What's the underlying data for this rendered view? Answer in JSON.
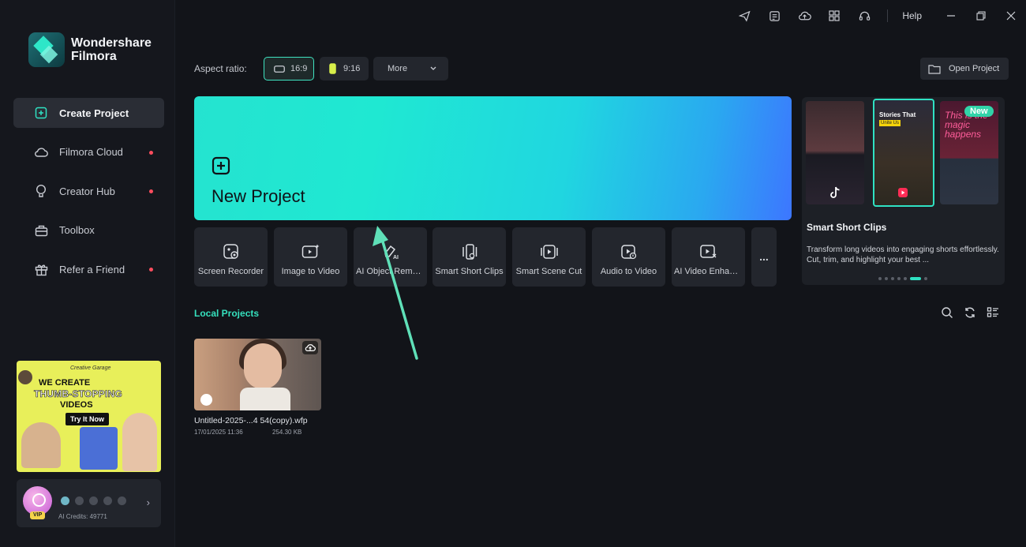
{
  "app": {
    "name_line1": "Wondershare",
    "name_line2": "Filmora"
  },
  "sidebar": {
    "items": [
      {
        "label": "Create Project",
        "icon": "plus-square-icon",
        "active": true,
        "dot": false
      },
      {
        "label": "Filmora Cloud",
        "icon": "cloud-icon",
        "active": false,
        "dot": true
      },
      {
        "label": "Creator Hub",
        "icon": "bulb-icon",
        "active": false,
        "dot": true
      },
      {
        "label": "Toolbox",
        "icon": "toolbox-icon",
        "active": false,
        "dot": false
      },
      {
        "label": "Refer a Friend",
        "icon": "gift-icon",
        "active": false,
        "dot": true
      }
    ],
    "promo": {
      "script": "Creative Garage",
      "line1": "WE CREATE",
      "line2": "THUMB-STOPPING",
      "line3": "VIDEOS",
      "button": "Try It Now"
    },
    "user": {
      "badge": "VIP",
      "credits": "AI Credits: 49771"
    }
  },
  "topbar": {
    "icons": [
      "send-icon",
      "list-icon",
      "cloud-upload-icon",
      "grid-icon",
      "headset-icon"
    ],
    "help": "Help"
  },
  "aspect": {
    "label": "Aspect ratio:",
    "options": [
      "16:9",
      "9:16"
    ],
    "selected": "16:9",
    "more": "More"
  },
  "open_project": "Open Project",
  "new_project": "New Project",
  "tools": [
    {
      "label": "Screen Recorder",
      "icon": "screen-recorder-icon"
    },
    {
      "label": "Image to Video",
      "icon": "image-to-video-icon"
    },
    {
      "label": "AI Object Remover",
      "icon": "ai-object-remover-icon"
    },
    {
      "label": "Smart Short Clips",
      "icon": "smart-short-clips-icon"
    },
    {
      "label": "Smart Scene Cut",
      "icon": "smart-scene-cut-icon"
    },
    {
      "label": "Audio to Video",
      "icon": "audio-to-video-icon"
    },
    {
      "label": "AI Video Enhancer",
      "icon": "ai-video-enhancer-icon"
    }
  ],
  "tools_more": "...",
  "carousel": {
    "badge": "New",
    "thumb_title": "Stories That",
    "thumb_subtitle": "Unite Us",
    "thumb_script": "This is the magic happens",
    "title": "Smart Short Clips",
    "description": "Transform long videos into engaging shorts effortlessly. Cut, trim, and highlight your best ...",
    "pages": 7,
    "active_page": 6
  },
  "local_projects": {
    "title": "Local Projects",
    "items": [
      {
        "name": "Untitled-2025-...4 54(copy).wfp",
        "date": "17/01/2025 11:36",
        "size": "254.30 KB"
      }
    ]
  },
  "colors": {
    "accent": "#35e0bd",
    "background": "#121419",
    "sidebar": "#15171d",
    "card": "#23262d",
    "dot": "#ff4d5e"
  }
}
